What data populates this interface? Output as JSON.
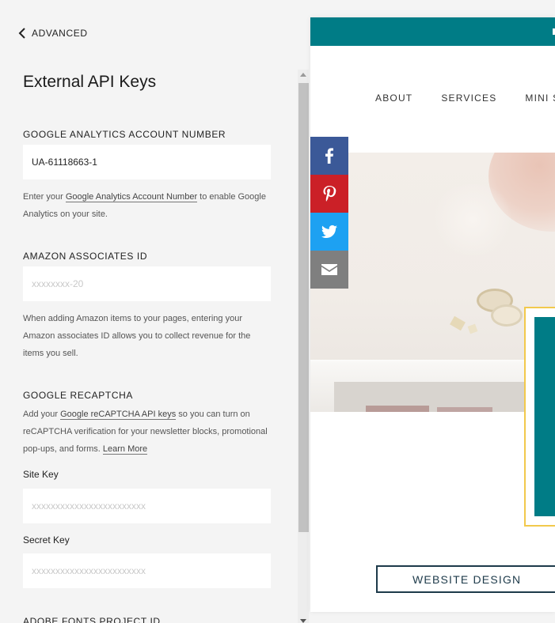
{
  "back": {
    "label": "ADVANCED",
    "icon": "chevron-left-icon"
  },
  "panel": {
    "title": "External API Keys",
    "google_analytics": {
      "label": "GOOGLE ANALYTICS ACCOUNT NUMBER",
      "value": "UA-61118663-1",
      "help_prefix": "Enter your ",
      "help_link": "Google Analytics Account Number",
      "help_suffix": " to enable Google Analytics on your site."
    },
    "amazon": {
      "label": "AMAZON ASSOCIATES ID",
      "placeholder": "xxxxxxxx-20",
      "help": "When adding Amazon items to your pages, entering your Amazon associates ID allows you to collect revenue for the items you sell."
    },
    "recaptcha": {
      "label": "GOOGLE RECAPTCHA",
      "help_prefix": "Add your ",
      "help_link": "Google reCAPTCHA API keys",
      "help_middle": " so you can turn on reCAPTCHA verification for your newsletter blocks, promotional pop-ups, and forms. ",
      "learn_more": "Learn More",
      "site_key_label": "Site Key",
      "site_key_placeholder": "xxxxxxxxxxxxxxxxxxxxxxxx",
      "secret_key_label": "Secret Key",
      "secret_key_placeholder": "xxxxxxxxxxxxxxxxxxxxxxxx"
    },
    "adobe_fonts": {
      "label": "ADOBE FONTS PROJECT ID"
    }
  },
  "preview": {
    "nav_items": [
      "ABOUT",
      "SERVICES",
      "MINI S"
    ],
    "cta_label": "WEBSITE DESIGN",
    "colors": {
      "teal": "#007c86",
      "gold": "#f2c94c",
      "navy": "#1d3a4a"
    }
  },
  "share": [
    {
      "name": "facebook",
      "color": "#3b5998",
      "icon": "facebook-icon"
    },
    {
      "name": "pinterest",
      "color": "#cb2027",
      "icon": "pinterest-icon"
    },
    {
      "name": "twitter",
      "color": "#1da1f2",
      "icon": "twitter-icon"
    },
    {
      "name": "email",
      "color": "#7f7f7f",
      "icon": "email-icon"
    }
  ]
}
